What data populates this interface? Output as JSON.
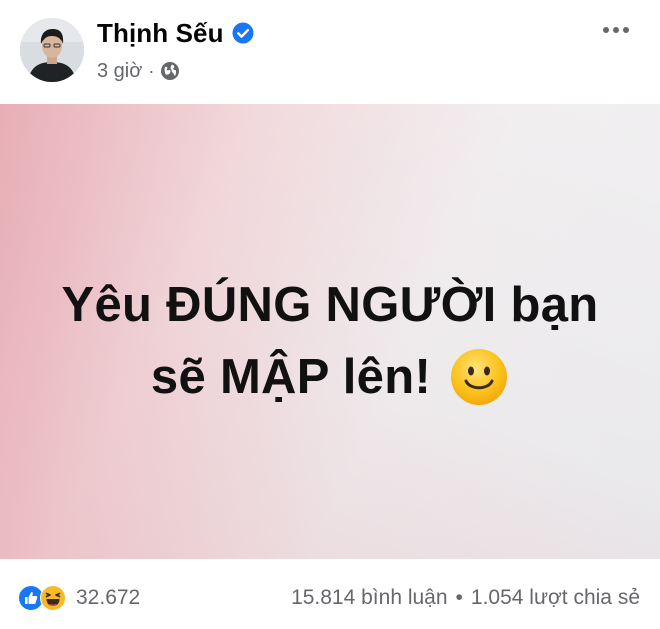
{
  "post": {
    "author_name": "Thịnh Sếu",
    "time": "3 giờ",
    "separator": "·",
    "text_line1": "Yêu ĐÚNG NGƯỜI bạn",
    "text_line2": "sẽ MẬP lên!",
    "reaction_count": "32.672",
    "comments": "15.814 bình luận",
    "dot": "•",
    "shares": "1.054 lượt chia sẻ"
  },
  "icons": {
    "verified": "verified-badge-icon",
    "privacy": "globe-icon",
    "emoji": "smiley-emoji-icon",
    "reaction_like": "like-reaction-icon",
    "reaction_haha": "haha-reaction-icon",
    "more": "more-options-icon"
  },
  "colors": {
    "verified_blue": "#1877f2",
    "like_blue": "#1877f2",
    "haha_yellow": "#f7b928",
    "meta_gray": "#65676b"
  }
}
